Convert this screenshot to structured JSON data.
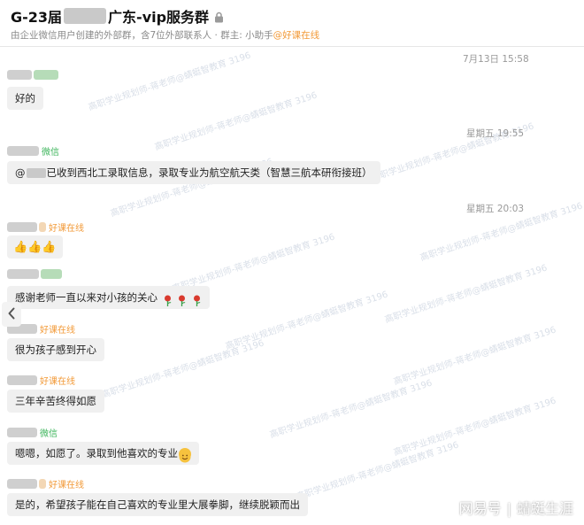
{
  "header": {
    "title_prefix": "G-23届",
    "title_suffix": "广东-vip服务群",
    "subtitle": "由企业微信用户创建的外部群，含7位外部联系人 · 群主: 小助手",
    "subtitle_org": "@好课在线"
  },
  "watermark": {
    "line": "高职学业规划师-蒋老师@蜻蜓智教育 3196",
    "footer_left": "网易号",
    "footer_right": "蜻蜓生涯"
  },
  "messages": [
    {
      "time": "7月13日 15:58",
      "tag": "",
      "text": "好的"
    },
    {
      "time": "星期五 19:55",
      "tag": "微信",
      "text_at": "@",
      "text": "已收到西北工录取信息，录取专业为航空航天类（智慧三航本研衔接班）"
    },
    {
      "time": "星期五 20:03",
      "tag": "好课在线",
      "text": ""
    },
    {
      "tag": "",
      "text": "感谢老师一直以来对小孩的关心"
    },
    {
      "tag": "好课在线",
      "text": "很为孩子感到开心"
    },
    {
      "tag": "好课在线",
      "text": "三年辛苦终得如愿"
    },
    {
      "tag": "微信",
      "text": "嗯嗯，如愿了。录取到他喜欢的专业"
    },
    {
      "tag": "好课在线",
      "text": "是的，希望孩子能在自己喜欢的专业里大展拳脚，继续脱颖而出"
    }
  ],
  "colors": {
    "accent_orange": "#f29a38",
    "wechat_green": "#3cb45b",
    "bubble": "#f0f0f0"
  },
  "icons": [
    "lock-icon",
    "chevron-left-icon",
    "thumbs-up-icon",
    "rose-icon",
    "smile-icon"
  ]
}
